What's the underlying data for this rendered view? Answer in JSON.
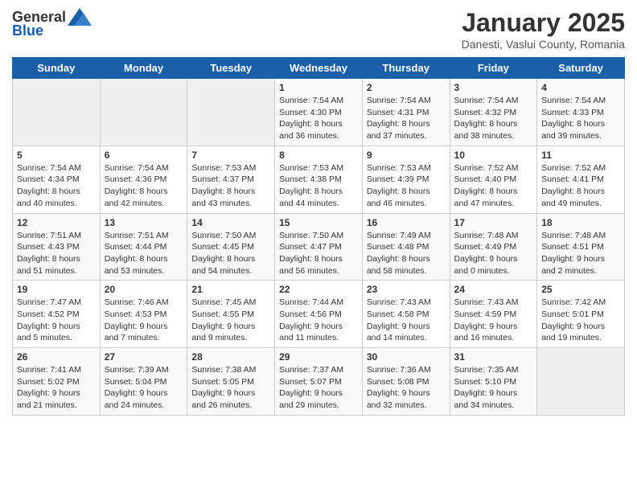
{
  "header": {
    "logo_general": "General",
    "logo_blue": "Blue",
    "month_title": "January 2025",
    "location": "Danesti, Vaslui County, Romania"
  },
  "days_of_week": [
    "Sunday",
    "Monday",
    "Tuesday",
    "Wednesday",
    "Thursday",
    "Friday",
    "Saturday"
  ],
  "weeks": [
    [
      {
        "day": "",
        "content": ""
      },
      {
        "day": "",
        "content": ""
      },
      {
        "day": "",
        "content": ""
      },
      {
        "day": "1",
        "content": "Sunrise: 7:54 AM\nSunset: 4:30 PM\nDaylight: 8 hours and 36 minutes."
      },
      {
        "day": "2",
        "content": "Sunrise: 7:54 AM\nSunset: 4:31 PM\nDaylight: 8 hours and 37 minutes."
      },
      {
        "day": "3",
        "content": "Sunrise: 7:54 AM\nSunset: 4:32 PM\nDaylight: 8 hours and 38 minutes."
      },
      {
        "day": "4",
        "content": "Sunrise: 7:54 AM\nSunset: 4:33 PM\nDaylight: 8 hours and 39 minutes."
      }
    ],
    [
      {
        "day": "5",
        "content": "Sunrise: 7:54 AM\nSunset: 4:34 PM\nDaylight: 8 hours and 40 minutes."
      },
      {
        "day": "6",
        "content": "Sunrise: 7:54 AM\nSunset: 4:36 PM\nDaylight: 8 hours and 42 minutes."
      },
      {
        "day": "7",
        "content": "Sunrise: 7:53 AM\nSunset: 4:37 PM\nDaylight: 8 hours and 43 minutes."
      },
      {
        "day": "8",
        "content": "Sunrise: 7:53 AM\nSunset: 4:38 PM\nDaylight: 8 hours and 44 minutes."
      },
      {
        "day": "9",
        "content": "Sunrise: 7:53 AM\nSunset: 4:39 PM\nDaylight: 8 hours and 46 minutes."
      },
      {
        "day": "10",
        "content": "Sunrise: 7:52 AM\nSunset: 4:40 PM\nDaylight: 8 hours and 47 minutes."
      },
      {
        "day": "11",
        "content": "Sunrise: 7:52 AM\nSunset: 4:41 PM\nDaylight: 8 hours and 49 minutes."
      }
    ],
    [
      {
        "day": "12",
        "content": "Sunrise: 7:51 AM\nSunset: 4:43 PM\nDaylight: 8 hours and 51 minutes."
      },
      {
        "day": "13",
        "content": "Sunrise: 7:51 AM\nSunset: 4:44 PM\nDaylight: 8 hours and 53 minutes."
      },
      {
        "day": "14",
        "content": "Sunrise: 7:50 AM\nSunset: 4:45 PM\nDaylight: 8 hours and 54 minutes."
      },
      {
        "day": "15",
        "content": "Sunrise: 7:50 AM\nSunset: 4:47 PM\nDaylight: 8 hours and 56 minutes."
      },
      {
        "day": "16",
        "content": "Sunrise: 7:49 AM\nSunset: 4:48 PM\nDaylight: 8 hours and 58 minutes."
      },
      {
        "day": "17",
        "content": "Sunrise: 7:48 AM\nSunset: 4:49 PM\nDaylight: 9 hours and 0 minutes."
      },
      {
        "day": "18",
        "content": "Sunrise: 7:48 AM\nSunset: 4:51 PM\nDaylight: 9 hours and 2 minutes."
      }
    ],
    [
      {
        "day": "19",
        "content": "Sunrise: 7:47 AM\nSunset: 4:52 PM\nDaylight: 9 hours and 5 minutes."
      },
      {
        "day": "20",
        "content": "Sunrise: 7:46 AM\nSunset: 4:53 PM\nDaylight: 9 hours and 7 minutes."
      },
      {
        "day": "21",
        "content": "Sunrise: 7:45 AM\nSunset: 4:55 PM\nDaylight: 9 hours and 9 minutes."
      },
      {
        "day": "22",
        "content": "Sunrise: 7:44 AM\nSunset: 4:56 PM\nDaylight: 9 hours and 11 minutes."
      },
      {
        "day": "23",
        "content": "Sunrise: 7:43 AM\nSunset: 4:58 PM\nDaylight: 9 hours and 14 minutes."
      },
      {
        "day": "24",
        "content": "Sunrise: 7:43 AM\nSunset: 4:59 PM\nDaylight: 9 hours and 16 minutes."
      },
      {
        "day": "25",
        "content": "Sunrise: 7:42 AM\nSunset: 5:01 PM\nDaylight: 9 hours and 19 minutes."
      }
    ],
    [
      {
        "day": "26",
        "content": "Sunrise: 7:41 AM\nSunset: 5:02 PM\nDaylight: 9 hours and 21 minutes."
      },
      {
        "day": "27",
        "content": "Sunrise: 7:39 AM\nSunset: 5:04 PM\nDaylight: 9 hours and 24 minutes."
      },
      {
        "day": "28",
        "content": "Sunrise: 7:38 AM\nSunset: 5:05 PM\nDaylight: 9 hours and 26 minutes."
      },
      {
        "day": "29",
        "content": "Sunrise: 7:37 AM\nSunset: 5:07 PM\nDaylight: 9 hours and 29 minutes."
      },
      {
        "day": "30",
        "content": "Sunrise: 7:36 AM\nSunset: 5:08 PM\nDaylight: 9 hours and 32 minutes."
      },
      {
        "day": "31",
        "content": "Sunrise: 7:35 AM\nSunset: 5:10 PM\nDaylight: 9 hours and 34 minutes."
      },
      {
        "day": "",
        "content": ""
      }
    ]
  ]
}
